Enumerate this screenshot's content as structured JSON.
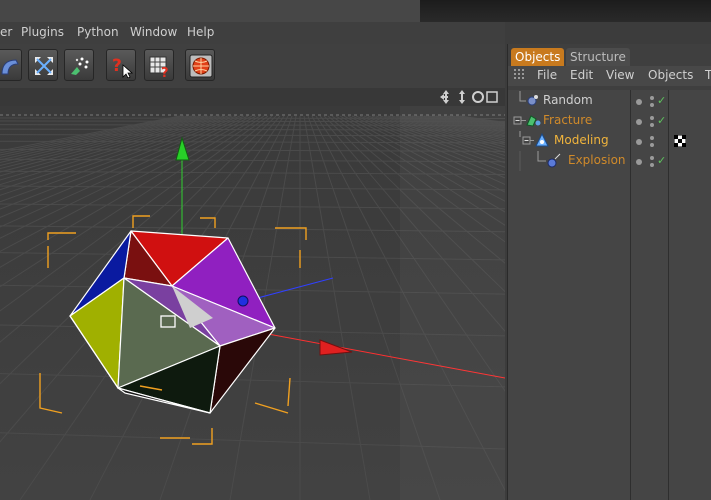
{
  "menubar": {
    "items": [
      "er",
      "Plugins",
      "Python",
      "Window",
      "Help"
    ]
  },
  "toolbar": {
    "buttons": [
      "deformer-icon",
      "fullscreen-icon",
      "particles-icon",
      "help-pointer-icon",
      "render-settings-icon",
      "render-icon"
    ]
  },
  "objects_panel": {
    "tabs": [
      "Objects",
      "Structure"
    ],
    "menu": [
      "File",
      "Edit",
      "View",
      "Objects",
      "T"
    ],
    "rows": [
      {
        "name": "Random",
        "color": "#cfcfcf"
      },
      {
        "name": "Fracture",
        "color": "#d08a2a"
      },
      {
        "name": "Modeling",
        "color": "#f0b43c"
      },
      {
        "name": "Explosion",
        "color": "#d08a2a"
      }
    ]
  },
  "colors": {
    "accent": "#c87a1e",
    "x_axis": "#ff3030",
    "y_axis": "#30c030",
    "z_axis": "#3040ff"
  }
}
